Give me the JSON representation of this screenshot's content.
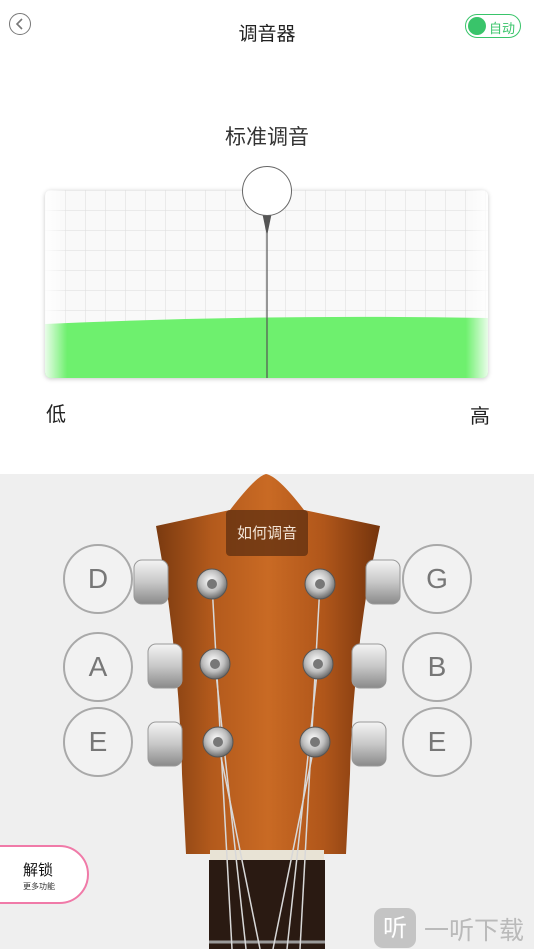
{
  "header": {
    "title": "调音器",
    "back_icon": "chevron-left-icon",
    "auto_toggle": {
      "label": "自动",
      "on": true,
      "color": "#39c46a"
    }
  },
  "tuner": {
    "mode": "标准调音",
    "low_label": "低",
    "high_label": "高",
    "meter_fill_color": "#6ef06e"
  },
  "headstock": {
    "help_label": "如何调音",
    "strings_left": [
      "D",
      "A",
      "E"
    ],
    "strings_right": [
      "G",
      "B",
      "E"
    ]
  },
  "unlock": {
    "label": "解锁",
    "sub_label": "更多功能",
    "border_color": "#f07aa8"
  },
  "watermark": {
    "icon_char": "听",
    "text": "一听下载"
  }
}
